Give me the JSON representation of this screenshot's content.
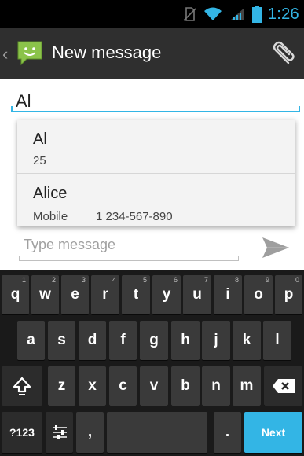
{
  "status_bar": {
    "time": "1:26",
    "icons": [
      "no-sim-icon",
      "wifi-icon",
      "signal-icon",
      "battery-icon"
    ]
  },
  "action_bar": {
    "back_glyph": "‹",
    "title": "New message",
    "app_icon": "messaging-app-icon",
    "attach_icon": "paperclip-icon"
  },
  "recipient": {
    "value": "Al"
  },
  "suggestions": [
    {
      "name": "Al",
      "detail": "25"
    },
    {
      "name": "Alice",
      "type": "Mobile",
      "phone": "1 234-567-890"
    }
  ],
  "composer": {
    "placeholder": "Type message",
    "send_icon": "send-icon"
  },
  "keyboard": {
    "row1": [
      {
        "label": "q",
        "hint": "1"
      },
      {
        "label": "w",
        "hint": "2"
      },
      {
        "label": "e",
        "hint": "3"
      },
      {
        "label": "r",
        "hint": "4"
      },
      {
        "label": "t",
        "hint": "5"
      },
      {
        "label": "y",
        "hint": "6"
      },
      {
        "label": "u",
        "hint": "7"
      },
      {
        "label": "i",
        "hint": "8"
      },
      {
        "label": "o",
        "hint": "9"
      },
      {
        "label": "p",
        "hint": "0"
      }
    ],
    "row2": [
      "a",
      "s",
      "d",
      "f",
      "g",
      "h",
      "j",
      "k",
      "l"
    ],
    "row3": [
      "z",
      "x",
      "c",
      "v",
      "b",
      "n",
      "m"
    ],
    "symbols_label": "?123",
    "comma_label": ",",
    "period_label": ".",
    "next_label": "Next",
    "colors": {
      "accent": "#33b5e5",
      "key_bg": "#3a3a3a",
      "keyboard_bg": "#1a1a1a"
    }
  }
}
